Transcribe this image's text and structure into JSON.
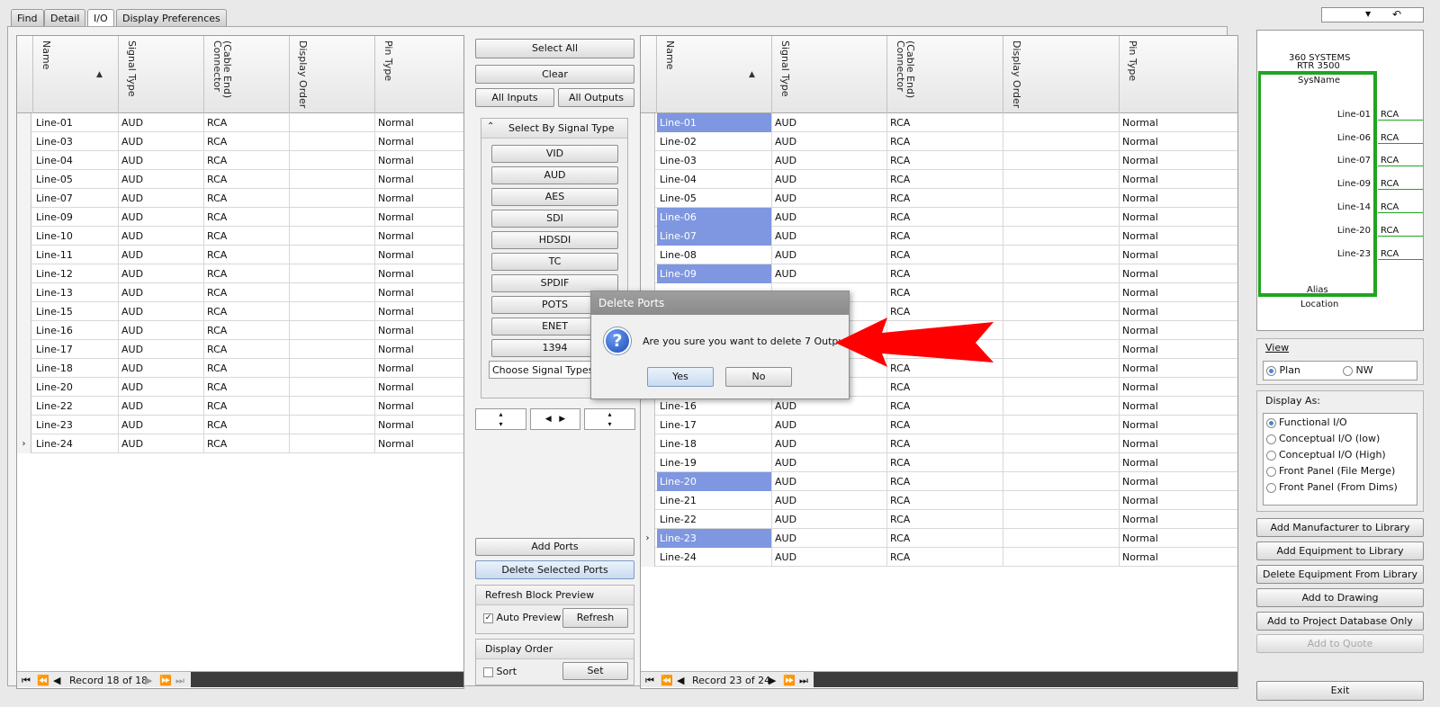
{
  "tabs": [
    "Find",
    "Detail",
    "I/O",
    "Display Preferences"
  ],
  "columns": [
    "Name",
    "Signal Type",
    "(Cable End)\nConnector",
    "Display Order",
    "Pin Type"
  ],
  "left_grid": {
    "rows": [
      {
        "name": "Line-01",
        "signal": "AUD",
        "connector": "RCA",
        "order": "",
        "pin": "Normal"
      },
      {
        "name": "Line-03",
        "signal": "AUD",
        "connector": "RCA",
        "order": "",
        "pin": "Normal"
      },
      {
        "name": "Line-04",
        "signal": "AUD",
        "connector": "RCA",
        "order": "",
        "pin": "Normal"
      },
      {
        "name": "Line-05",
        "signal": "AUD",
        "connector": "RCA",
        "order": "",
        "pin": "Normal"
      },
      {
        "name": "Line-07",
        "signal": "AUD",
        "connector": "RCA",
        "order": "",
        "pin": "Normal"
      },
      {
        "name": "Line-09",
        "signal": "AUD",
        "connector": "RCA",
        "order": "",
        "pin": "Normal"
      },
      {
        "name": "Line-10",
        "signal": "AUD",
        "connector": "RCA",
        "order": "",
        "pin": "Normal"
      },
      {
        "name": "Line-11",
        "signal": "AUD",
        "connector": "RCA",
        "order": "",
        "pin": "Normal"
      },
      {
        "name": "Line-12",
        "signal": "AUD",
        "connector": "RCA",
        "order": "",
        "pin": "Normal"
      },
      {
        "name": "Line-13",
        "signal": "AUD",
        "connector": "RCA",
        "order": "",
        "pin": "Normal"
      },
      {
        "name": "Line-15",
        "signal": "AUD",
        "connector": "RCA",
        "order": "",
        "pin": "Normal"
      },
      {
        "name": "Line-16",
        "signal": "AUD",
        "connector": "RCA",
        "order": "",
        "pin": "Normal"
      },
      {
        "name": "Line-17",
        "signal": "AUD",
        "connector": "RCA",
        "order": "",
        "pin": "Normal"
      },
      {
        "name": "Line-18",
        "signal": "AUD",
        "connector": "RCA",
        "order": "",
        "pin": "Normal"
      },
      {
        "name": "Line-20",
        "signal": "AUD",
        "connector": "RCA",
        "order": "",
        "pin": "Normal"
      },
      {
        "name": "Line-22",
        "signal": "AUD",
        "connector": "RCA",
        "order": "",
        "pin": "Normal"
      },
      {
        "name": "Line-23",
        "signal": "AUD",
        "connector": "RCA",
        "order": "",
        "pin": "Normal"
      },
      {
        "name": "Line-24",
        "signal": "AUD",
        "connector": "RCA",
        "order": "",
        "pin": "Normal",
        "current": true
      }
    ],
    "record_text": "Record 18 of 18"
  },
  "right_grid": {
    "rows": [
      {
        "name": "Line-01",
        "signal": "AUD",
        "connector": "RCA",
        "order": "",
        "pin": "Normal",
        "selected": true
      },
      {
        "name": "Line-02",
        "signal": "AUD",
        "connector": "RCA",
        "order": "",
        "pin": "Normal"
      },
      {
        "name": "Line-03",
        "signal": "AUD",
        "connector": "RCA",
        "order": "",
        "pin": "Normal"
      },
      {
        "name": "Line-04",
        "signal": "AUD",
        "connector": "RCA",
        "order": "",
        "pin": "Normal"
      },
      {
        "name": "Line-05",
        "signal": "AUD",
        "connector": "RCA",
        "order": "",
        "pin": "Normal"
      },
      {
        "name": "Line-06",
        "signal": "AUD",
        "connector": "RCA",
        "order": "",
        "pin": "Normal",
        "selected": true
      },
      {
        "name": "Line-07",
        "signal": "AUD",
        "connector": "RCA",
        "order": "",
        "pin": "Normal",
        "selected": true
      },
      {
        "name": "Line-08",
        "signal": "AUD",
        "connector": "RCA",
        "order": "",
        "pin": "Normal"
      },
      {
        "name": "Line-09",
        "signal": "AUD",
        "connector": "RCA",
        "order": "",
        "pin": "Normal",
        "selected": true
      },
      {
        "name": "",
        "signal": "",
        "connector": "RCA",
        "order": "",
        "pin": "Normal"
      },
      {
        "name": "",
        "signal": "",
        "connector": "RCA",
        "order": "",
        "pin": "Normal"
      },
      {
        "name": "",
        "signal": "",
        "connector": "",
        "order": "",
        "pin": "Normal"
      },
      {
        "name": "",
        "signal": "",
        "connector": "",
        "order": "",
        "pin": "Normal"
      },
      {
        "name": "",
        "signal": "",
        "connector": "RCA",
        "order": "",
        "pin": "Normal"
      },
      {
        "name": "",
        "signal": "",
        "connector": "RCA",
        "order": "",
        "pin": "Normal"
      },
      {
        "name": "Line-16",
        "signal": "AUD",
        "connector": "RCA",
        "order": "",
        "pin": "Normal"
      },
      {
        "name": "Line-17",
        "signal": "AUD",
        "connector": "RCA",
        "order": "",
        "pin": "Normal"
      },
      {
        "name": "Line-18",
        "signal": "AUD",
        "connector": "RCA",
        "order": "",
        "pin": "Normal"
      },
      {
        "name": "Line-19",
        "signal": "AUD",
        "connector": "RCA",
        "order": "",
        "pin": "Normal"
      },
      {
        "name": "Line-20",
        "signal": "AUD",
        "connector": "RCA",
        "order": "",
        "pin": "Normal",
        "selected": true
      },
      {
        "name": "Line-21",
        "signal": "AUD",
        "connector": "RCA",
        "order": "",
        "pin": "Normal"
      },
      {
        "name": "Line-22",
        "signal": "AUD",
        "connector": "RCA",
        "order": "",
        "pin": "Normal"
      },
      {
        "name": "Line-23",
        "signal": "AUD",
        "connector": "RCA",
        "order": "",
        "pin": "Normal",
        "selected": true,
        "current": true
      },
      {
        "name": "Line-24",
        "signal": "AUD",
        "connector": "RCA",
        "order": "",
        "pin": "Normal"
      }
    ],
    "record_text": "Record 23 of 24"
  },
  "middle": {
    "select_all": "Select All",
    "clear": "Clear",
    "all_inputs": "All Inputs",
    "all_outputs": "All Outputs",
    "select_by_signal_title": "Select By Signal Type",
    "signal_buttons": [
      "VID",
      "AUD",
      "AES",
      "SDI",
      "HDSDI",
      "TC",
      "SPDIF",
      "POTS",
      "ENET",
      "1394"
    ],
    "choose_signal_types": "Choose Signal Types",
    "add_ports": "Add Ports",
    "delete_selected_ports": "Delete Selected Ports",
    "refresh_title": "Refresh Block Preview",
    "auto_preview": "Auto Preview",
    "refresh": "Refresh",
    "display_order_title": "Display Order",
    "sort": "Sort",
    "set": "Set"
  },
  "preview": {
    "manufacturer": "360 SYSTEMS",
    "model": "RTR 3500",
    "sysname": "SysName",
    "ports": [
      {
        "name": "Line-01",
        "connector": "RCA"
      },
      {
        "name": "Line-06",
        "connector": "RCA"
      },
      {
        "name": "Line-07",
        "connector": "RCA"
      },
      {
        "name": "Line-09",
        "connector": "RCA"
      },
      {
        "name": "Line-14",
        "connector": "RCA"
      },
      {
        "name": "Line-20",
        "connector": "RCA"
      },
      {
        "name": "Line-23",
        "connector": "RCA"
      }
    ],
    "alias": "Alias",
    "location": "Location",
    "block_color": "#1fa51f"
  },
  "view": {
    "title": "View",
    "options": [
      "Plan",
      "NW"
    ],
    "selected": "Plan"
  },
  "display_as": {
    "title": "Display As:",
    "options": [
      "Functional I/O",
      "Conceptual I/O (low)",
      "Conceptual I/O (High)",
      "Front Panel (File Merge)",
      "Front Panel (From Dims)"
    ],
    "selected": "Functional I/O"
  },
  "right_buttons": [
    "Add Manufacturer to Library",
    "Add Equipment to Library",
    "Delete Equipment From Library",
    "Add to Drawing",
    "Add to Project Database Only",
    "Add to Quote"
  ],
  "exit": "Exit",
  "dialog": {
    "title": "Delete Ports",
    "message": "Are you sure you want to delete 7 Outputs ?",
    "yes": "Yes",
    "no": "No"
  },
  "colors": {
    "selection": "#7f97e0",
    "arrow": "#ff0000"
  }
}
